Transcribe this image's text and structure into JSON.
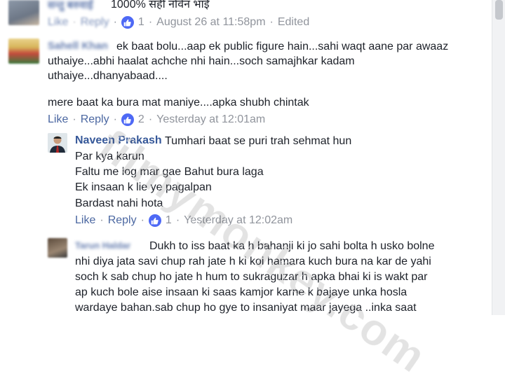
{
  "comment_top": {
    "name": "सन्तु बरुवाई",
    "text": "1000% सही नोवेन भाई",
    "reply_label": "Reply",
    "like_count": "1",
    "timestamp": "August 26 at 11:58pm",
    "edited_label": "Edited"
  },
  "comment_sahil": {
    "name": "Sahell Khan",
    "lines": [
      "ek baat bolu...aap ek public figure hain...sahi waqt aane par awaaz",
      "uthaiye...abhi haalat achche nhi hain...soch samajhkar kadam",
      "uthaiye...dhanyabaad....",
      "mere baat ka bura mat maniye....apka shubh chintak"
    ],
    "like_label": "Like",
    "reply_label": "Reply",
    "like_count": "2",
    "timestamp": "Yesterday at 12:01am"
  },
  "reply_naveen": {
    "name": "Naveen Prakash",
    "lines": [
      "Tumhari baat se puri trah sehmat hun",
      "Par kya karun",
      "Faltu me log mar gae Bahut bura laga",
      "Ek insaan k lie ye pagalpan",
      "Bardast nahi hota"
    ],
    "like_label": "Like",
    "reply_label": "Reply",
    "like_count": "1",
    "timestamp": "Yesterday at 12:02am"
  },
  "reply_tarun": {
    "name": "Tarun Haldar",
    "lines": [
      "Dukh to iss baat ka h bahanji ki jo sahi bolta h usko bolne",
      "nhi diya jata savi chup rah jate h ki koi hamara kuch bura na kar de yahi",
      "soch k sab chup ho jate h hum to sukraguzar h apka bhai ki is wakt par",
      "ap kuch bole aise insaan ki saas kamjor karne k bajaye unka hosla",
      "wardaye bahan.sab chup ho gye to insaniyat maar jayega ..inka saat"
    ]
  },
  "watermark": "filmymonkey.com",
  "colors": {
    "link": "#4b67a1",
    "name": "#365899",
    "meta": "#90949c",
    "like_badge": "#4e69f5"
  }
}
